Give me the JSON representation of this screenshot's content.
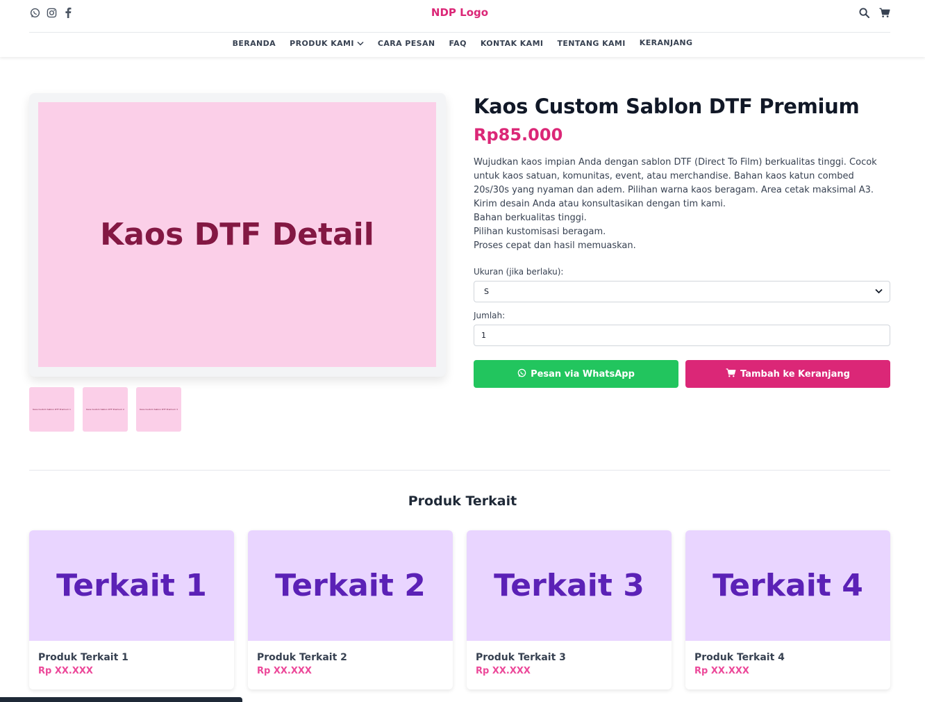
{
  "header": {
    "logo": "NDP Logo",
    "social_icons": [
      "whatsapp-icon",
      "instagram-icon",
      "facebook-icon"
    ],
    "action_icons": [
      "search-icon",
      "cart-icon"
    ]
  },
  "nav": {
    "items": [
      {
        "label": "BERANDA"
      },
      {
        "label": "PRODUK KAMI"
      },
      {
        "label": "CARA PESAN"
      },
      {
        "label": "FAQ"
      },
      {
        "label": "KONTAK KAMI"
      },
      {
        "label": "TENTANG KAMI"
      },
      {
        "label": "KERANJANG"
      }
    ]
  },
  "product": {
    "image_text": "Kaos DTF Detail",
    "thumbs": [
      "Kaos Custom Sablon DTF Premium 1",
      "Kaos Custom Sablon DTF Premium 2",
      "Kaos Custom Sablon DTF Premium 3"
    ],
    "title": "Kaos Custom Sablon DTF Premium",
    "price": "Rp85.000",
    "description": [
      "Wujudkan kaos impian Anda dengan sablon DTF (Direct To Film) berkualitas tinggi. Cocok untuk kaos satuan, komunitas, event, atau merchandise. Bahan kaos katun combed 20s/30s yang nyaman dan adem. Pilihan warna kaos beragam. Area cetak maksimal A3. Kirim desain Anda atau konsultasikan dengan tim kami.",
      "Bahan berkualitas tinggi.",
      "Pilihan kustomisasi beragam.",
      "Proses cepat dan hasil memuaskan."
    ],
    "size_label": "Ukuran (jika berlaku):",
    "size_value": "S",
    "qty_label": "Jumlah:",
    "qty_value": "1",
    "wa_button": "Pesan via WhatsApp",
    "cart_button": "Tambah ke Keranjang"
  },
  "related": {
    "title": "Produk Terkait",
    "items": [
      {
        "image_text": "Terkait 1",
        "name": "Produk Terkait 1",
        "price": "Rp XX.XXX"
      },
      {
        "image_text": "Terkait 2",
        "name": "Produk Terkait 2",
        "price": "Rp XX.XXX"
      },
      {
        "image_text": "Terkait 3",
        "name": "Produk Terkait 3",
        "price": "Rp XX.XXX"
      },
      {
        "image_text": "Terkait 4",
        "name": "Produk Terkait 4",
        "price": "Rp XX.XXX"
      }
    ]
  },
  "colors": {
    "brand_pink": "#db2777",
    "whatsapp_green": "#22c55e",
    "image_pink": "#fbcfe8",
    "related_purple": "#e9d5ff"
  }
}
